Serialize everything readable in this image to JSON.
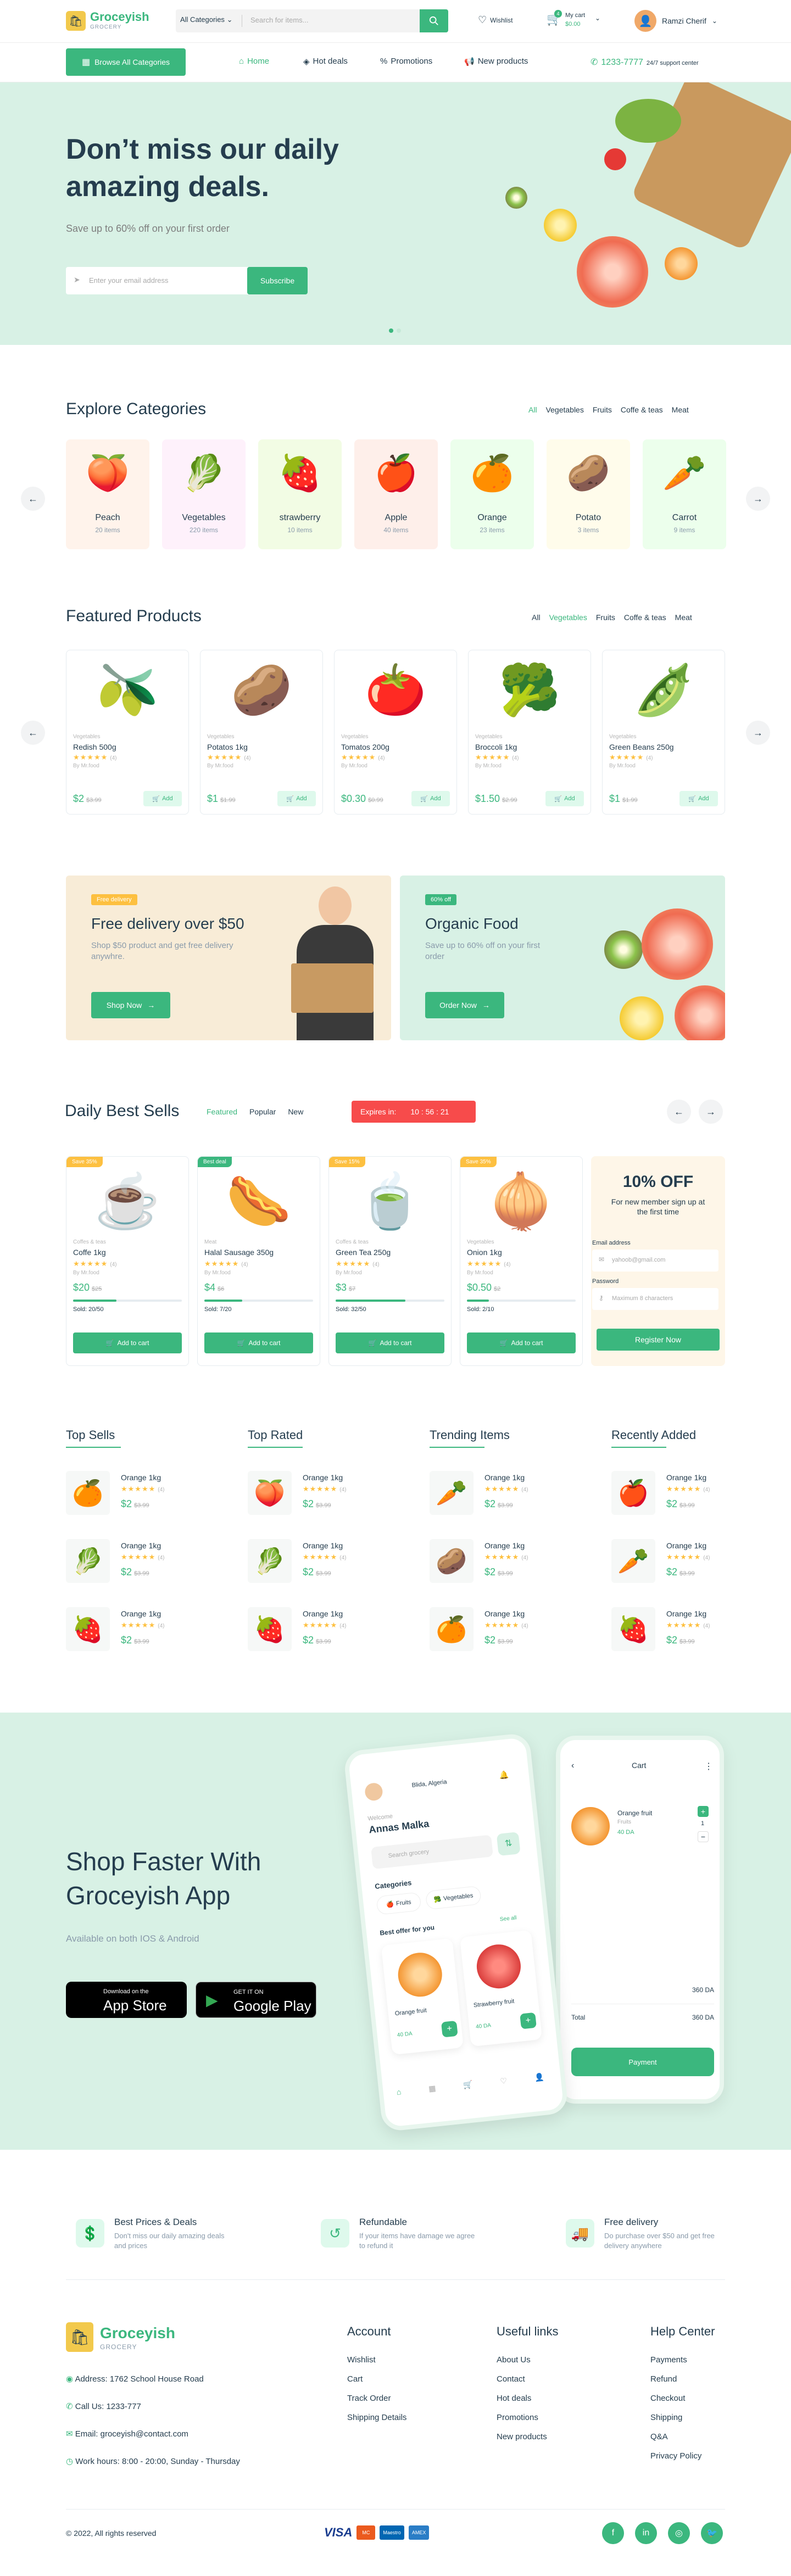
{
  "header": {
    "logo": "Groceyish",
    "logo_sub": "GROCERY",
    "category_select": "All Categories",
    "search_placeholder": "Search for items...",
    "wishlist": "Wishlist",
    "cart_count": "4",
    "cart_label": "My cart",
    "cart_total": "$0.00",
    "user_name": "Ramzi Cherif"
  },
  "nav": {
    "browse": "Browse All Categories",
    "links": [
      "Home",
      "Hot deals",
      "Promotions",
      "New products"
    ],
    "phone": "1233-7777",
    "support": "24/7 support center"
  },
  "hero": {
    "title_line1": "Don’t miss our daily",
    "title_line2": "amazing deals.",
    "subtitle": "Save up to 60% off on your first order",
    "email_placeholder": "Enter your email address",
    "subscribe": "Subscribe"
  },
  "categories": {
    "title": "Explore Categories",
    "filters": [
      "All",
      "Vegetables",
      "Fruits",
      "Coffe & teas",
      "Meat"
    ],
    "items": [
      {
        "name": "Peach",
        "count": "20 items",
        "bg": "#fff3eb",
        "icon": "🍑"
      },
      {
        "name": "Vegetables",
        "count": "220 items",
        "bg": "#fef1fb",
        "icon": "🥬"
      },
      {
        "name": "strawberry",
        "count": "10 items",
        "bg": "#f2fce4",
        "icon": "🍓"
      },
      {
        "name": "Apple",
        "count": "40 items",
        "bg": "#feefea",
        "icon": "🍎"
      },
      {
        "name": "Orange",
        "count": "23 items",
        "bg": "#ecffec",
        "icon": "🍊"
      },
      {
        "name": "Potato",
        "count": "3 items",
        "bg": "#fffceb",
        "icon": "🥔"
      },
      {
        "name": "Carrot",
        "count": "9 items",
        "bg": "#ecffec",
        "icon": "🥕"
      }
    ]
  },
  "featured": {
    "title": "Featured Products",
    "filters": [
      "All",
      "Vegetables",
      "Fruits",
      "Coffe & teas",
      "Meat"
    ],
    "products": [
      {
        "cat": "Vegetables",
        "name": "Redish 500g",
        "rating": "(4)",
        "by": "By Mr.food",
        "price": "$2",
        "old": "$3.99",
        "icon": "🫒"
      },
      {
        "cat": "Vegetables",
        "name": "Potatos 1kg",
        "rating": "(4)",
        "by": "By Mr.food",
        "price": "$1",
        "old": "$1.99",
        "icon": "🥔"
      },
      {
        "cat": "Vegetables",
        "name": "Tomatos 200g",
        "rating": "(4)",
        "by": "By Mr.food",
        "price": "$0.30",
        "old": "$0.99",
        "icon": "🍅"
      },
      {
        "cat": "Vegetables",
        "name": "Broccoli 1kg",
        "rating": "(4)",
        "by": "By Mr.food",
        "price": "$1.50",
        "old": "$2.99",
        "icon": "🥦"
      },
      {
        "cat": "Vegetables",
        "name": "Green Beans 250g",
        "rating": "(4)",
        "by": "By Mr.food",
        "price": "$1",
        "old": "$1.99",
        "icon": "🫛"
      }
    ],
    "add": "Add"
  },
  "banners": [
    {
      "badge": "Free delivery",
      "title": "Free delivery over $50",
      "text": "Shop $50 product and get free delivery anywhre.",
      "btn": "Shop Now"
    },
    {
      "badge": "60% off",
      "title": "Organic Food",
      "text": "Save up to 60% off on your first order",
      "btn": "Order Now"
    }
  ],
  "daily": {
    "title": "Daily Best Sells",
    "tabs": [
      "Featured",
      "Popular",
      "New"
    ],
    "expires_label": "Expires in:",
    "timer": "10 : 56 : 21",
    "add": "Add to cart",
    "products": [
      {
        "tag": "Save 35%",
        "tag_color": "#fdc040",
        "cat": "Coffes & teas",
        "name": "Coffe 1kg",
        "rating": "(4)",
        "by": "By Mr.food",
        "price": "$20",
        "old": "$25",
        "sold": "Sold: 20/50",
        "pct": 0.4,
        "icon": "☕"
      },
      {
        "tag": "Best deal",
        "tag_color": "#3bb77e",
        "cat": "Meat",
        "name": "Halal Sausage 350g",
        "rating": "(4)",
        "by": "By Mr.food",
        "price": "$4",
        "old": "$6",
        "sold": "Sold: 7/20",
        "pct": 0.35,
        "icon": "🌭"
      },
      {
        "tag": "Save 15%",
        "tag_color": "#fdc040",
        "cat": "Coffes & teas",
        "name": "Green Tea 250g",
        "rating": "(4)",
        "by": "By Mr.food",
        "price": "$3",
        "old": "$7",
        "sold": "Sold: 32/50",
        "pct": 0.64,
        "icon": "🍵"
      },
      {
        "tag": "Save 35%",
        "tag_color": "#fdc040",
        "cat": "Vegetables",
        "name": "Onion 1kg",
        "rating": "(4)",
        "by": "By Mr.food",
        "price": "$0.50",
        "old": "$2",
        "sold": "Sold: 2/10",
        "pct": 0.2,
        "icon": "🧅"
      }
    ],
    "promo": {
      "title": "10% OFF",
      "text": "For new member sign up at the first time",
      "email_label": "Email address",
      "email_placeholder": "yahoob@gmail.com",
      "password_label": "Password",
      "password_placeholder": "Maximum 8 characters",
      "btn": "Register Now"
    }
  },
  "lists": [
    {
      "title": "Top Sells",
      "items": [
        {
          "name": "Orange 1kg",
          "price": "$2",
          "old": "$3.99",
          "icon": "🍊"
        },
        {
          "name": "Orange 1kg",
          "price": "$2",
          "old": "$3.99",
          "icon": "🥬"
        },
        {
          "name": "Orange 1kg",
          "price": "$2",
          "old": "$3.99",
          "icon": "🍓"
        }
      ]
    },
    {
      "title": "Top Rated",
      "items": [
        {
          "name": "Orange 1kg",
          "price": "$2",
          "old": "$3.99",
          "icon": "🍑"
        },
        {
          "name": "Orange 1kg",
          "price": "$2",
          "old": "$3.99",
          "icon": "🥬"
        },
        {
          "name": "Orange 1kg",
          "price": "$2",
          "old": "$3.99",
          "icon": "🍓"
        }
      ]
    },
    {
      "title": "Trending Items",
      "items": [
        {
          "name": "Orange 1kg",
          "price": "$2",
          "old": "$3.99",
          "icon": "🥕"
        },
        {
          "name": "Orange 1kg",
          "price": "$2",
          "old": "$3.99",
          "icon": "🥔"
        },
        {
          "name": "Orange 1kg",
          "price": "$2",
          "old": "$3.99",
          "icon": "🍊"
        }
      ]
    },
    {
      "title": "Recently Added",
      "items": [
        {
          "name": "Orange 1kg",
          "price": "$2",
          "old": "$3.99",
          "icon": "🍎"
        },
        {
          "name": "Orange 1kg",
          "price": "$2",
          "old": "$3.99",
          "icon": "🥕"
        },
        {
          "name": "Orange 1kg",
          "price": "$2",
          "old": "$3.99",
          "icon": "🍓"
        }
      ]
    }
  ],
  "app": {
    "title_line1": "Shop Faster With",
    "title_line2": "Groceyish App",
    "subtitle": "Available on both IOS & Android",
    "appstore_small": "Download on the",
    "appstore": "App Store",
    "gplay_small": "GET IT ON",
    "gplay": "Google Play",
    "phone1_location": "Blida, Algeria",
    "phone1_welcome": "Welcome",
    "phone1_name": "Annas Malka",
    "phone1_search": "Search grocery",
    "phone1_categories": "Categories",
    "phone1_cat1": "Fruits",
    "phone1_cat2": "Vegetables",
    "phone1_offer": "Best offer for you",
    "phone1_seeall": "See all",
    "phone1_p1": "Orange fruit",
    "phone1_p1_price": "40 DA",
    "phone1_p2": "Strawberry fruit",
    "phone1_p2_price": "40 DA",
    "phone2_title": "Cart",
    "phone2_item": "Orange fruit",
    "phone2_item_sub": "Fruits",
    "phone2_price": "40 DA",
    "phone2_total1": "360 DA",
    "phone2_total_label": "Total",
    "phone2_total2": "360 DA",
    "phone2_btn": "Payment"
  },
  "features": [
    {
      "title": "Best Prices & Deals",
      "text": "Don't miss our daily amazing deals and prices"
    },
    {
      "title": "Refundable",
      "text": "If your items have damage we agree to refund it"
    },
    {
      "title": "Free delivery",
      "text": "Do purchase over $50 and get free delivery anywhere"
    }
  ],
  "footer": {
    "logo": "Groceyish",
    "logo_sub": "GROCERY",
    "address_label": "Address:",
    "address": "1762 School House Road",
    "call_label": "Call Us:",
    "call": "1233-777",
    "email_label": "Email:",
    "email": "groceyish@contact.com",
    "hours_label": "Work hours:",
    "hours": "8:00 - 20:00, Sunday - Thursday",
    "cols": [
      {
        "title": "Account",
        "links": [
          "Wishlist",
          "Cart",
          "Track Order",
          "Shipping Details"
        ]
      },
      {
        "title": "Useful links",
        "links": [
          "About Us",
          "Contact",
          "Hot deals",
          "Promotions",
          "New products"
        ]
      },
      {
        "title": "Help Center",
        "links": [
          "Payments",
          "Refund",
          "Checkout",
          "Shipping",
          "Q&A",
          "Privacy Policy"
        ]
      }
    ],
    "copyright": "© 2022, All rights reserved",
    "payments": [
      "VISA",
      "MC",
      "Maestro",
      "AMEX"
    ],
    "socials": [
      "f",
      "in",
      "◎",
      "🐦"
    ]
  },
  "colors": {
    "primary": "#3bb77e",
    "dark": "#253d4e",
    "hero_bg": "#d8f1e5",
    "timer": "#f74b4b"
  }
}
